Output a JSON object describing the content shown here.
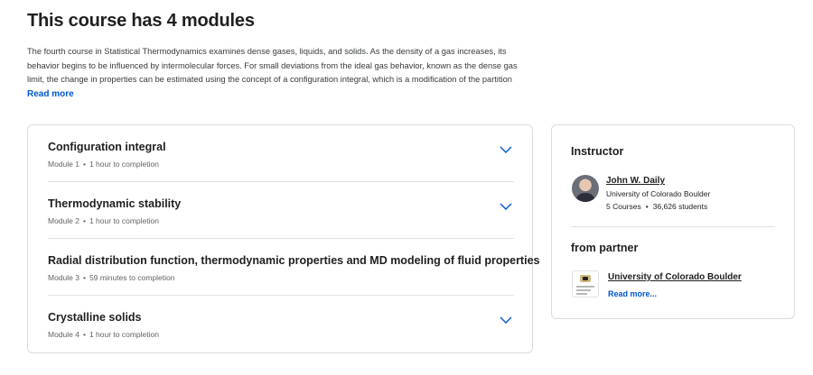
{
  "header": {
    "title": "This course has 4 modules"
  },
  "description": {
    "text": "The fourth course in Statistical Thermodynamics examines dense gases, liquids, and solids. As the density of a gas increases, its behavior begins to be influenced by intermolecular forces. For small deviations from the ideal gas behavior, known as the dense gas limit, the change in properties can be estimated using the concept of a configuration integral, which is a modification of the partition",
    "read_more": "Read more"
  },
  "modules": [
    {
      "title": "Configuration integral",
      "label": "Module 1",
      "separator": "•",
      "duration": "1 hour to completion",
      "chevron": "chevron-down-icon"
    },
    {
      "title": "Thermodynamic stability",
      "label": "Module 2",
      "separator": "•",
      "duration": "1 hour to completion",
      "chevron": "chevron-down-icon"
    },
    {
      "title": "Radial distribution function, thermodynamic properties and MD modeling of fluid properties",
      "label": "Module 3",
      "separator": "•",
      "duration": "59 minutes to completion"
    },
    {
      "title": "Crystalline solids",
      "label": "Module 4",
      "separator": "•",
      "duration": "1 hour to completion",
      "chevron": "chevron-down-icon"
    }
  ],
  "instructor": {
    "heading": "Instructor",
    "name": "John W. Daily",
    "organization": "University of Colorado Boulder",
    "courses": "5 Courses",
    "separator": "•",
    "students": "36,626 students"
  },
  "partner": {
    "heading": "from partner",
    "name": "University of Colorado Boulder",
    "read_more": "Read more..."
  },
  "colors": {
    "accent": "#0056d2",
    "border": "#dadce0",
    "text": "#1f1f1f",
    "muted": "#5f6368"
  }
}
